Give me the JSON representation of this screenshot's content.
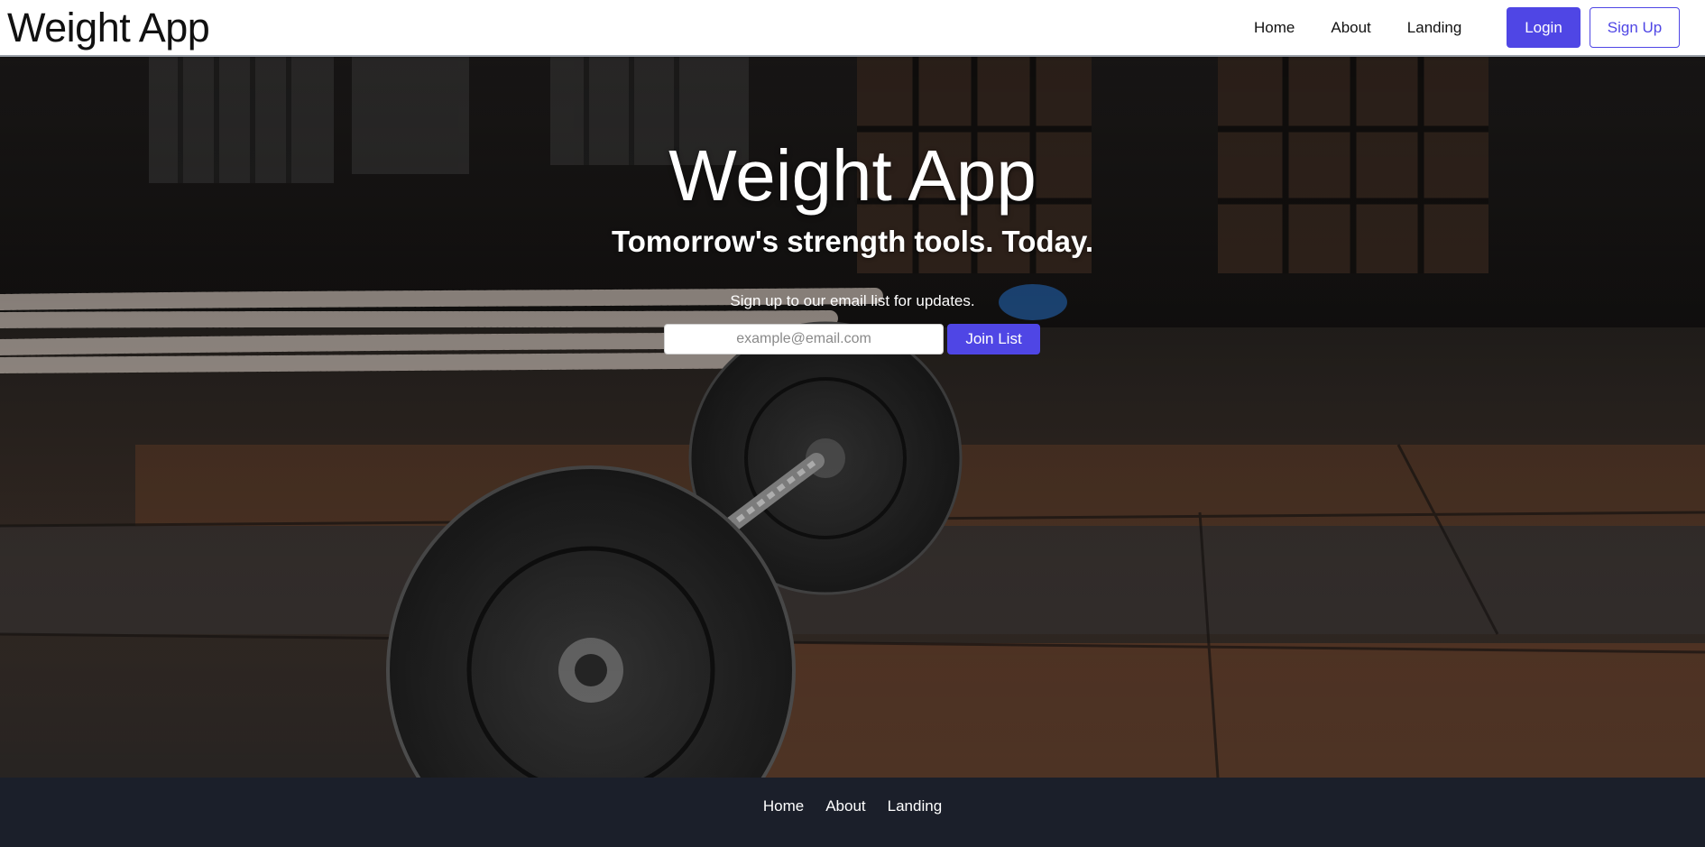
{
  "header": {
    "brand": "Weight App",
    "nav": [
      {
        "label": "Home"
      },
      {
        "label": "About"
      },
      {
        "label": "Landing"
      }
    ],
    "login_label": "Login",
    "signup_label": "Sign Up"
  },
  "hero": {
    "title": "Weight App",
    "tagline": "Tomorrow's strength tools. Today.",
    "signup_text": "Sign up to our email list for updates.",
    "email_placeholder": "example@email.com",
    "email_value": "",
    "join_label": "Join List",
    "background_image": "gym-floor-barbell-photo"
  },
  "footer": {
    "links": [
      {
        "label": "Home"
      },
      {
        "label": "About"
      },
      {
        "label": "Landing"
      }
    ]
  },
  "colors": {
    "accent": "#4f46e5",
    "footer_bg": "#1b1f2a",
    "header_bg": "#ffffff"
  }
}
